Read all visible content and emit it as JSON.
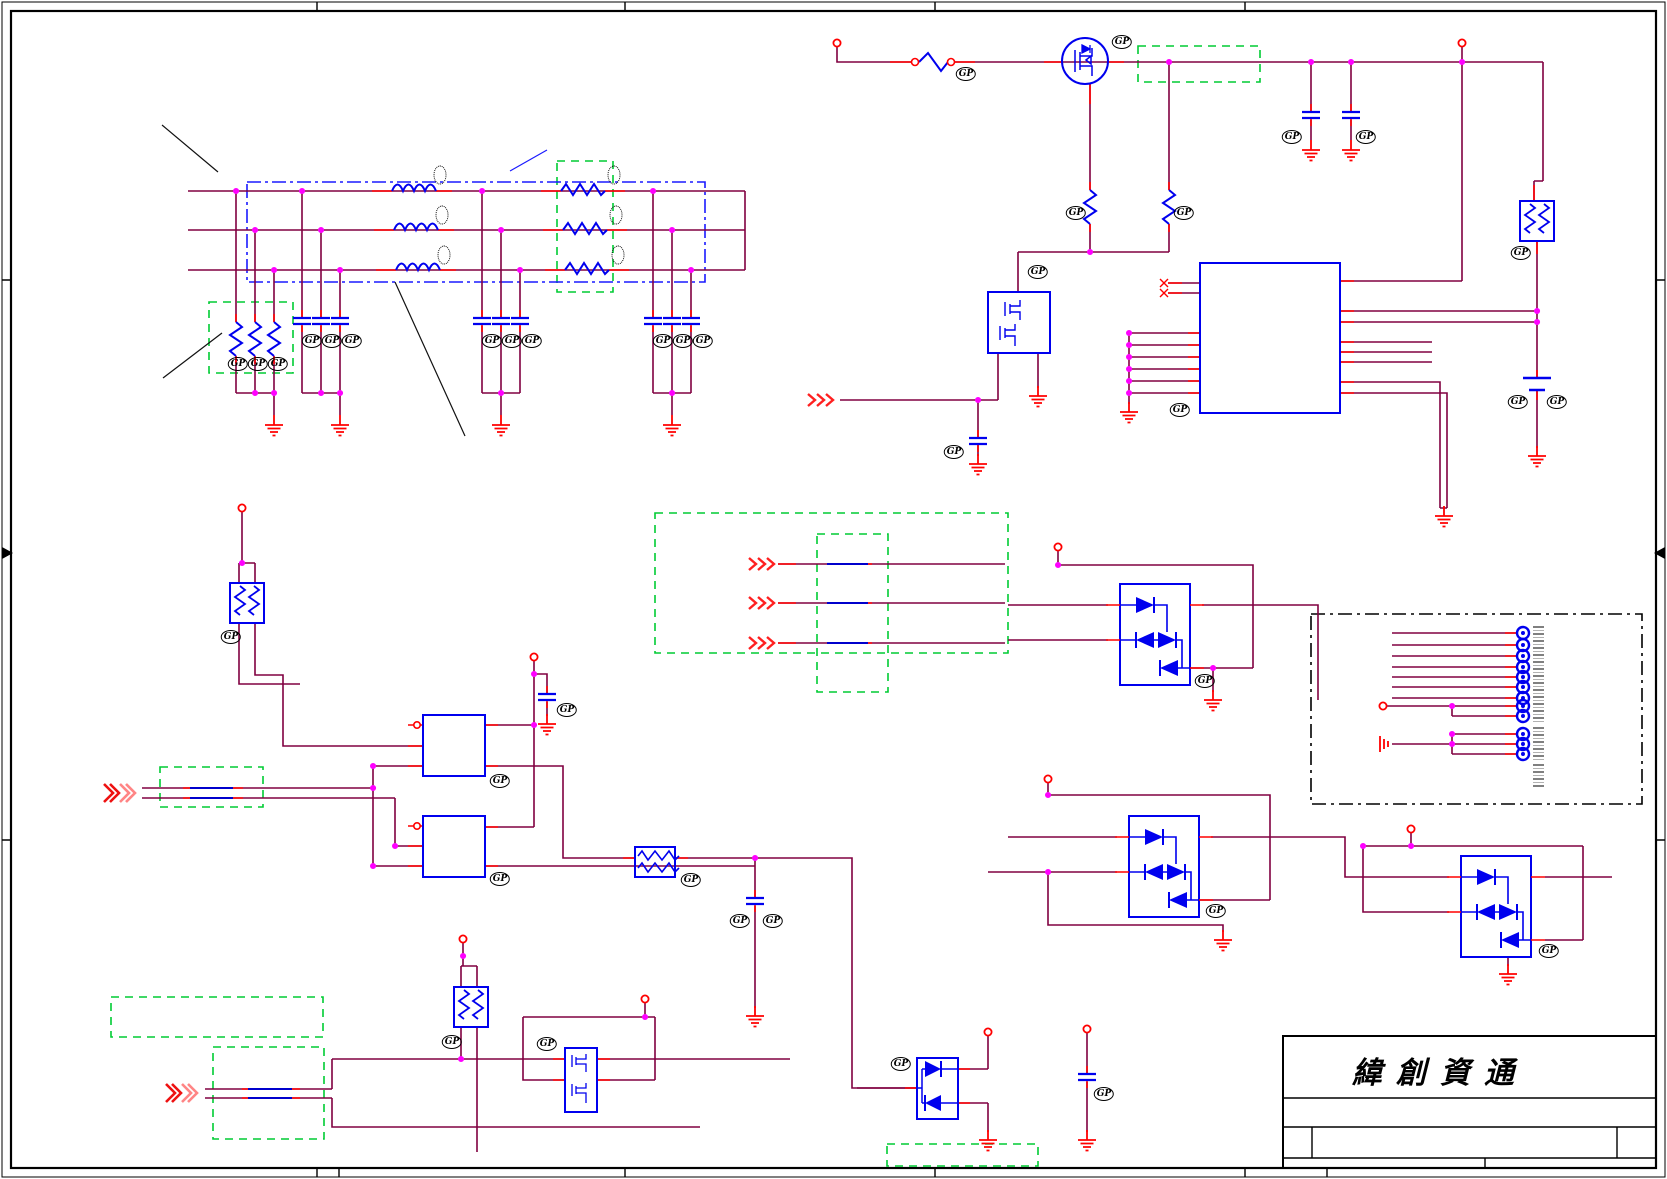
{
  "title_block": {
    "company_name": "緯創資通",
    "subtitle_row": "",
    "revision_row": ""
  },
  "labels": {
    "ref": "GP"
  },
  "symbols": {
    "off_page_connector": "triple-chevron",
    "off_page_connector_double": "double-chevron",
    "no_connect": "x-mark",
    "junction": "magenta-dot",
    "ground": "red-ground-stack"
  },
  "colors": {
    "wire": "#800040",
    "pin_red": "#ff0000",
    "component_blue": "#0000ee",
    "annotation_green": "#00cc33",
    "junction_magenta": "#ff00ff",
    "border_black": "#000000"
  }
}
